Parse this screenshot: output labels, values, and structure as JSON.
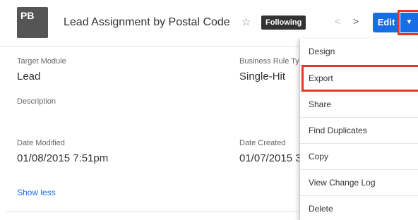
{
  "header": {
    "avatar_initials": "PB",
    "title": "Lead Assignment by Postal Code",
    "star_icon": "star-outline-icon",
    "following_label": "Following",
    "prev_icon": "chevron-left-icon",
    "next_icon": "chevron-right-icon",
    "edit_label": "Edit",
    "caret_icon": "caret-down-icon"
  },
  "fields": {
    "target_module": {
      "label": "Target Module",
      "value": "Lead"
    },
    "business_rule_type": {
      "label": "Business Rule Ty",
      "value": "Single-Hit"
    },
    "description": {
      "label": "Description",
      "value": ""
    },
    "date_modified": {
      "label": "Date Modified",
      "value": "01/08/2015 7:51pm"
    },
    "date_created": {
      "label": "Date Created",
      "value": "01/07/2015 3"
    }
  },
  "show_less_label": "Show less",
  "actions_menu": {
    "items": [
      "Design",
      "Export",
      "Share",
      "Find Duplicates",
      "Copy",
      "View Change Log",
      "Delete"
    ],
    "highlighted": "Export"
  },
  "colors": {
    "accent": "#176de5",
    "highlight_border": "#e5371d",
    "following_badge": "#333333",
    "avatar": "#555555"
  }
}
